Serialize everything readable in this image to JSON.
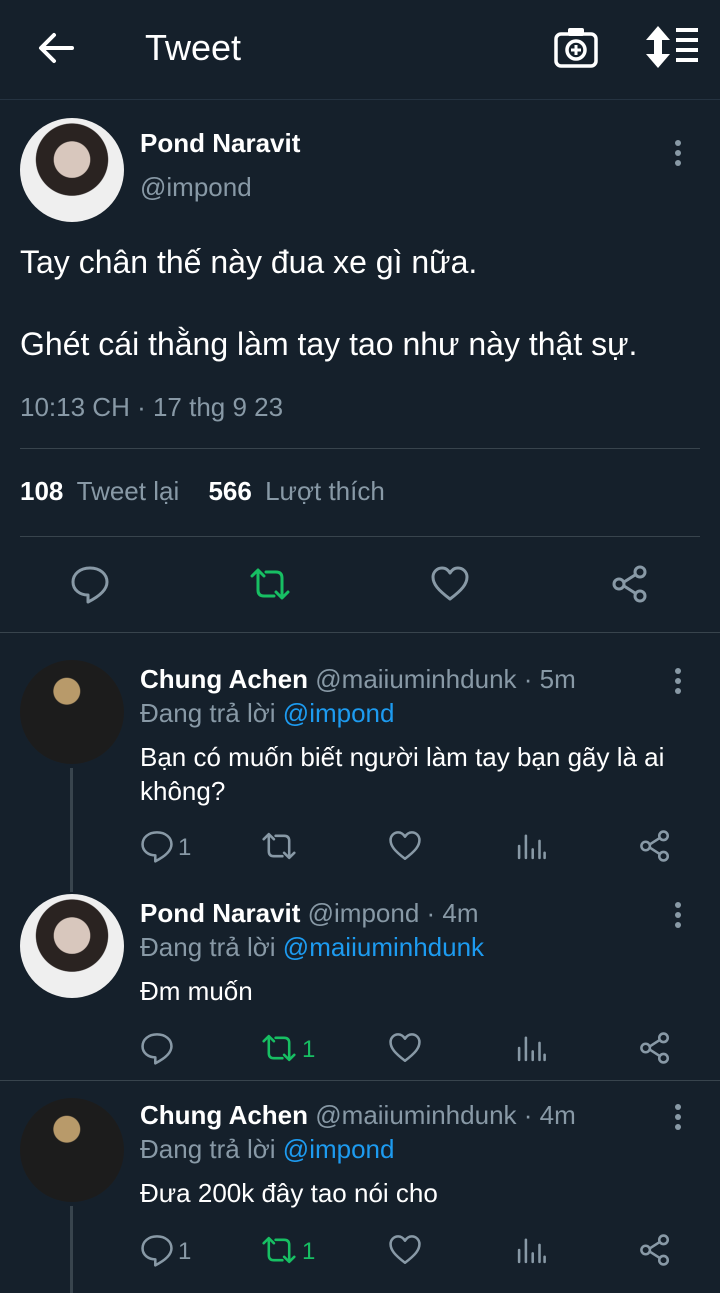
{
  "header": {
    "title": "Tweet"
  },
  "main_tweet": {
    "name": "Pond Naravit",
    "handle": "@impond",
    "line1": "Tay chân thế này đua xe gì nữa.",
    "line2": "Ghét cái thằng làm tay tao như này thật sự.",
    "time": "10:13 CH · 17 thg 9 23",
    "retweet_count": "108",
    "retweet_label": "Tweet lại",
    "like_count": "566",
    "like_label": "Lượt thích"
  },
  "replies": [
    {
      "name": "Chung Achen",
      "handle": "@maiiuminhdunk · 5m",
      "replying_prefix": "Đang trả lời",
      "replying_to": "@impond",
      "text": "Bạn có muốn biết người làm tay bạn gãy là ai không?",
      "reply_count": "1",
      "retweet_count": ""
    },
    {
      "name": "Pond Naravit",
      "handle": "@impond · 4m",
      "replying_prefix": "Đang trả lời",
      "replying_to": "@maiiuminhdunk",
      "text": "Đm muốn",
      "reply_count": "",
      "retweet_count": "1"
    },
    {
      "name": "Chung Achen",
      "handle": "@maiiuminhdunk · 4m",
      "replying_prefix": "Đang trả lời",
      "replying_to": "@impond",
      "text": "Đưa 200k đây tao nói cho",
      "reply_count": "1",
      "retweet_count": "1"
    }
  ],
  "colors": {
    "background": "#15202b",
    "secondary_text": "#8899a6",
    "link": "#1d9bf0",
    "retweet_active": "#17bf63"
  }
}
